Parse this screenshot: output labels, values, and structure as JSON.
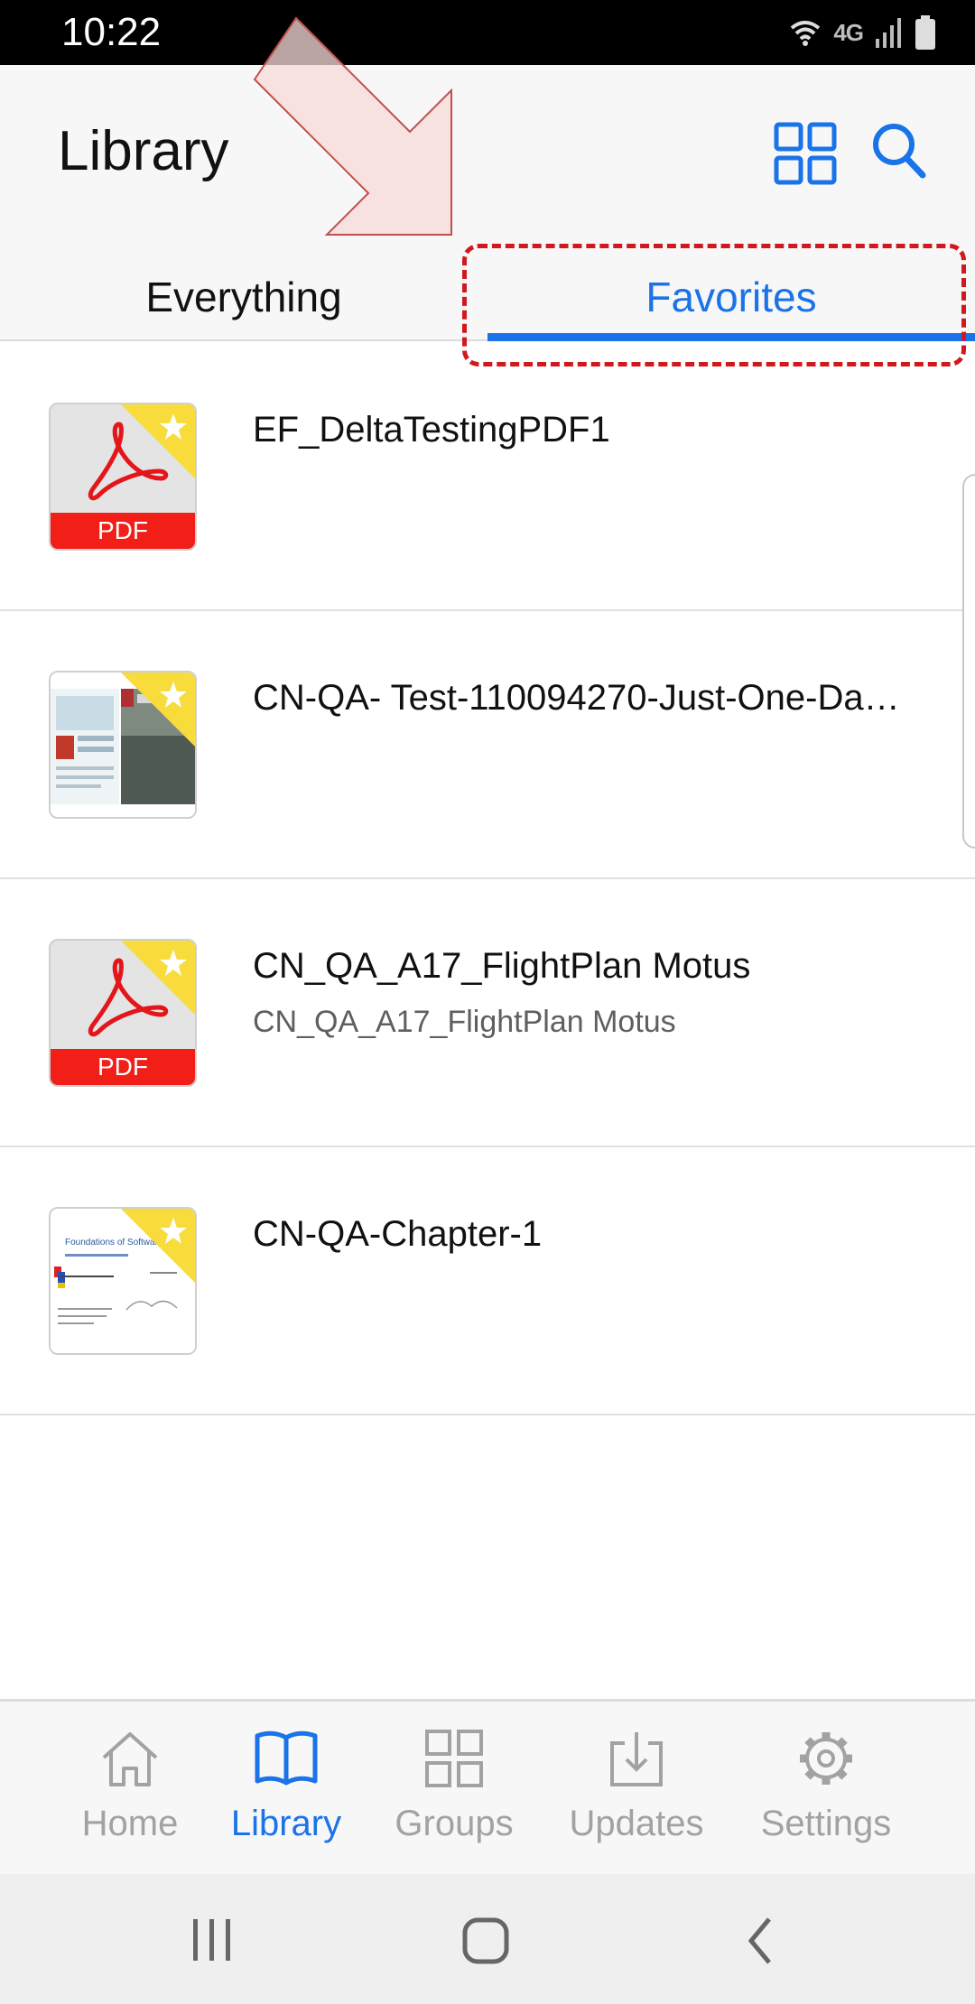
{
  "status_bar": {
    "time": "10:22",
    "network": "4G",
    "icons": [
      "wifi-icon",
      "signal-icon",
      "battery-icon"
    ]
  },
  "header": {
    "title": "Library",
    "actions": [
      "grid-view-icon",
      "search-icon"
    ]
  },
  "tabs": [
    {
      "label": "Everything",
      "selected": false
    },
    {
      "label": "Favorites",
      "selected": true
    }
  ],
  "documents": [
    {
      "title": "EF_DeltaTestingPDF1",
      "subtitle": "",
      "thumbnail": "pdf",
      "favorite": true
    },
    {
      "title": "CN-QA- Test-110094270-Just-One-Da…",
      "subtitle": "",
      "thumbnail": "magazine-cover",
      "favorite": true
    },
    {
      "title": "CN_QA_A17_FlightPlan Motus",
      "subtitle": "CN_QA_A17_FlightPlan Motus",
      "thumbnail": "pdf",
      "favorite": true
    },
    {
      "title": "CN-QA-Chapter-1",
      "subtitle": "",
      "thumbnail": "slide-page",
      "favorite": true
    }
  ],
  "thumb_labels": {
    "pdf": "PDF",
    "slide_heading": "Foundations of Software Tes"
  },
  "bottom_nav": [
    {
      "label": "Home",
      "icon": "home-icon",
      "active": false
    },
    {
      "label": "Library",
      "icon": "book-icon",
      "active": true
    },
    {
      "label": "Groups",
      "icon": "groups-icon",
      "active": false
    },
    {
      "label": "Updates",
      "icon": "download-icon",
      "active": false
    },
    {
      "label": "Settings",
      "icon": "gear-icon",
      "active": false
    }
  ],
  "colors": {
    "accent": "#1a73e8",
    "annotation_red": "#d0191e",
    "pdf_red": "#f11f17",
    "star_yellow": "#f7dc3b",
    "inactive": "#a2a2a2"
  }
}
